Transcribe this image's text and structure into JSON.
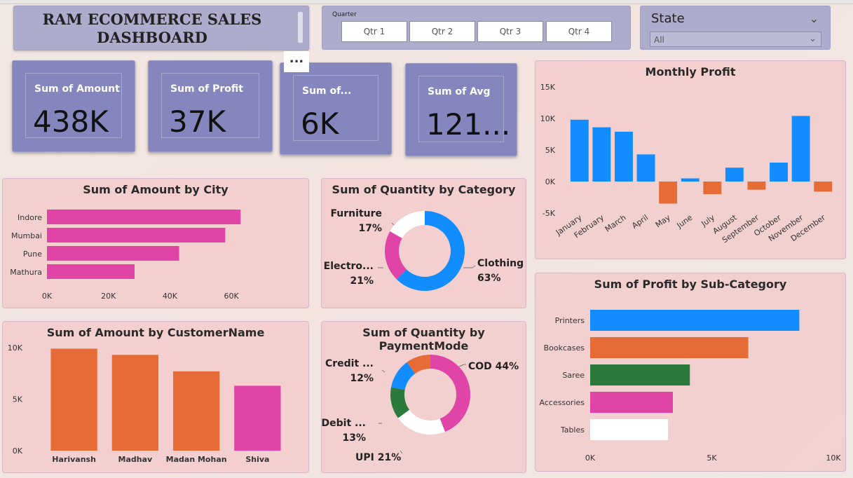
{
  "header": {
    "title_line1": "RAM ECOMMERCE SALES",
    "title_line2": "DASHBOARD"
  },
  "quarter_filter": {
    "label": "Quarter",
    "options": [
      "Qtr 1",
      "Qtr 2",
      "Qtr 3",
      "Qtr 4"
    ]
  },
  "state_filter": {
    "label": "State",
    "value": "All"
  },
  "visual_menu": "...",
  "kpis": [
    {
      "label": "Sum of Amount",
      "value": "438K"
    },
    {
      "label": "Sum of Profit",
      "value": "37K"
    },
    {
      "label": "Sum of...",
      "value": "6K"
    },
    {
      "label": "Sum of Avg",
      "value": "121..."
    }
  ],
  "colors": {
    "blue": "#118dff",
    "orange": "#e66c37",
    "pink": "#e044a7",
    "green": "#2b7a3b",
    "white": "#ffffff",
    "kpi_bg": "#8586bd",
    "filter_bg": "#aeaccd"
  },
  "chart_data": [
    {
      "id": "amount_by_city",
      "type": "bar",
      "orientation": "horizontal",
      "title": "Sum of Amount by City",
      "categories": [
        "Indore",
        "Mumbai",
        "Pune",
        "Mathura"
      ],
      "values": [
        63000,
        58000,
        43000,
        28500
      ],
      "xlim": [
        0,
        70000
      ],
      "ticks": [
        "0K",
        "20K",
        "40K",
        "60K"
      ],
      "tick_values": [
        0,
        20000,
        40000,
        60000
      ],
      "color": "#e044a7"
    },
    {
      "id": "quantity_by_category",
      "type": "pie",
      "variant": "donut",
      "title": "Sum of Quantity by Category",
      "slices": [
        {
          "name": "Clothing",
          "pct": "63%",
          "value": 63,
          "color": "#118dff"
        },
        {
          "name": "Electro...",
          "pct": "21%",
          "value": 21,
          "color": "#e044a7"
        },
        {
          "name": "Furniture",
          "pct": "17%",
          "value": 17,
          "color": "#ffffff"
        }
      ]
    },
    {
      "id": "monthly_profit",
      "type": "bar",
      "title": "Monthly Profit",
      "categories": [
        "January",
        "February",
        "March",
        "April",
        "May",
        "June",
        "July",
        "August",
        "September",
        "October",
        "November",
        "December"
      ],
      "values": [
        9800,
        8600,
        7900,
        4300,
        -3500,
        500,
        -2000,
        2200,
        -1300,
        3000,
        10400,
        -1600
      ],
      "ylim": [
        -5000,
        15000
      ],
      "ticks": [
        "-5K",
        "0K",
        "5K",
        "10K",
        "15K"
      ],
      "tick_values": [
        -5000,
        0,
        5000,
        10000,
        15000
      ],
      "pos_color": "#118dff",
      "neg_color": "#e66c37"
    },
    {
      "id": "amount_by_customer",
      "type": "bar",
      "title": "Sum of Amount by CustomerName",
      "categories": [
        "Harivansh",
        "Madhav",
        "Madan Mohan",
        "Shiva"
      ],
      "values": [
        9900,
        9300,
        7700,
        6300
      ],
      "ylim": [
        0,
        10000
      ],
      "ticks": [
        "0K",
        "5K",
        "10K"
      ],
      "tick_values": [
        0,
        5000,
        10000
      ],
      "colors": [
        "#e66c37",
        "#e66c37",
        "#e66c37",
        "#e044a7"
      ]
    },
    {
      "id": "quantity_by_payment",
      "type": "pie",
      "variant": "donut",
      "title": "Sum of Quantity by PaymentMode",
      "slices": [
        {
          "name": "COD",
          "pct": "44%",
          "value": 44,
          "color": "#e044a7"
        },
        {
          "name": "UPI",
          "pct": "21%",
          "value": 21,
          "color": "#ffffff"
        },
        {
          "name": "Debit ...",
          "pct": "13%",
          "value": 13,
          "color": "#2b7a3b"
        },
        {
          "name": "Credit ...",
          "pct": "12%",
          "value": 12,
          "color": "#118dff"
        },
        {
          "name": "",
          "pct": "",
          "value": 10,
          "color": "#e66c37"
        }
      ]
    },
    {
      "id": "profit_by_subcategory",
      "type": "bar",
      "orientation": "horizontal",
      "title": "Sum of Profit by Sub-Category",
      "categories": [
        "Printers",
        "Bookcases",
        "Saree",
        "Accessories",
        "Tables"
      ],
      "values": [
        8600,
        6500,
        4100,
        3400,
        3200
      ],
      "xlim": [
        0,
        10000
      ],
      "ticks": [
        "0K",
        "5K",
        "10K"
      ],
      "tick_values": [
        0,
        5000,
        10000
      ],
      "colors": [
        "#118dff",
        "#e66c37",
        "#2b7a3b",
        "#e044a7",
        "#ffffff"
      ]
    }
  ]
}
